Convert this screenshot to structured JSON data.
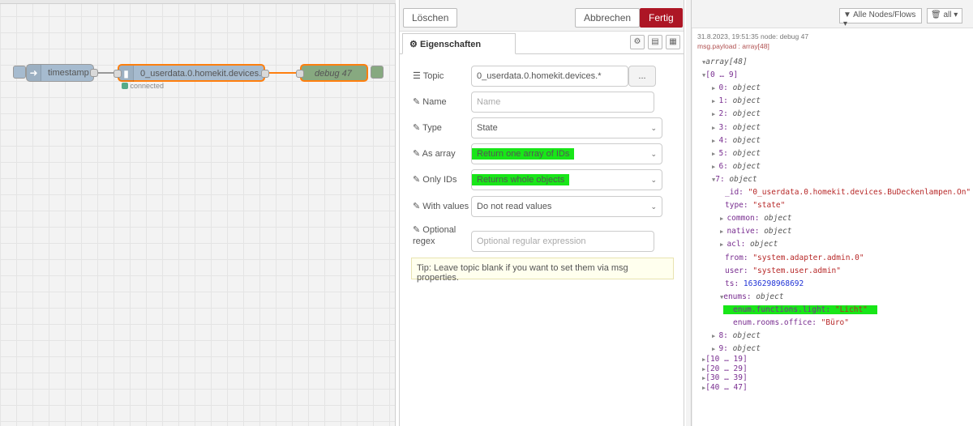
{
  "canvas": {
    "nodes": [
      {
        "label": "timestamp"
      },
      {
        "label": "0_userdata.0.homekit.devices.*",
        "status": "connected"
      },
      {
        "label": "debug 47"
      }
    ]
  },
  "editor": {
    "buttons": {
      "delete": "Löschen",
      "cancel": "Abbrechen",
      "done": "Fertig"
    },
    "tab": "Eigenschaften",
    "fields": {
      "topic": {
        "label": "Topic",
        "value": "0_userdata.0.homekit.devices.*",
        "browse": "..."
      },
      "name": {
        "label": "Name",
        "placeholder": "Name"
      },
      "type": {
        "label": "Type",
        "value": "State"
      },
      "as_array": {
        "label": "As array",
        "value": "Return one array of IDs"
      },
      "only_ids": {
        "label": "Only IDs",
        "value": "Returns whole objects"
      },
      "with_values": {
        "label": "With values",
        "value": "Do not read values"
      },
      "regex": {
        "label1": "Optional",
        "label2": "regex",
        "placeholder": "Optional regular expression"
      }
    },
    "tip": "Tip: Leave topic blank if you want to set them via msg properties."
  },
  "debug": {
    "filter": "Alle Nodes/Flows",
    "clear": "all",
    "meta": "31.8.2023, 19:51:35   node: debug 47",
    "payload": "msg.payload : array[48]",
    "tree": {
      "root": "array[48]",
      "group0": "[0 … 9]",
      "items_pre": [
        "0",
        "1",
        "2",
        "3",
        "4",
        "5",
        "6"
      ],
      "item_type": "object",
      "item7": "7",
      "id_key": "_id",
      "id_val": "\"0_userdata.0.homekit.devices.BuDeckenlampen.On\"",
      "type_key": "type",
      "type_val": "\"state\"",
      "common_key": "common",
      "native_key": "native",
      "acl_key": "acl",
      "from_key": "from",
      "from_val": "\"system.adapter.admin.0\"",
      "user_key": "user",
      "user_val": "\"system.user.admin\"",
      "ts_key": "ts",
      "ts_val": "1636298968692",
      "enums_key": "enums",
      "enum1_key": "enum.functions.light",
      "enum1_val": "\"Licht\"",
      "enum2_key": "enum.rooms.office",
      "enum2_val": "\"Büro\"",
      "items_post": [
        "8",
        "9"
      ],
      "groups": [
        "[10 … 19]",
        "[20 … 29]",
        "[30 … 39]",
        "[40 … 47]"
      ]
    }
  },
  "colors": {
    "highlight": "#18e618",
    "primary": "#ad1625",
    "node": "#a6bbcf"
  }
}
